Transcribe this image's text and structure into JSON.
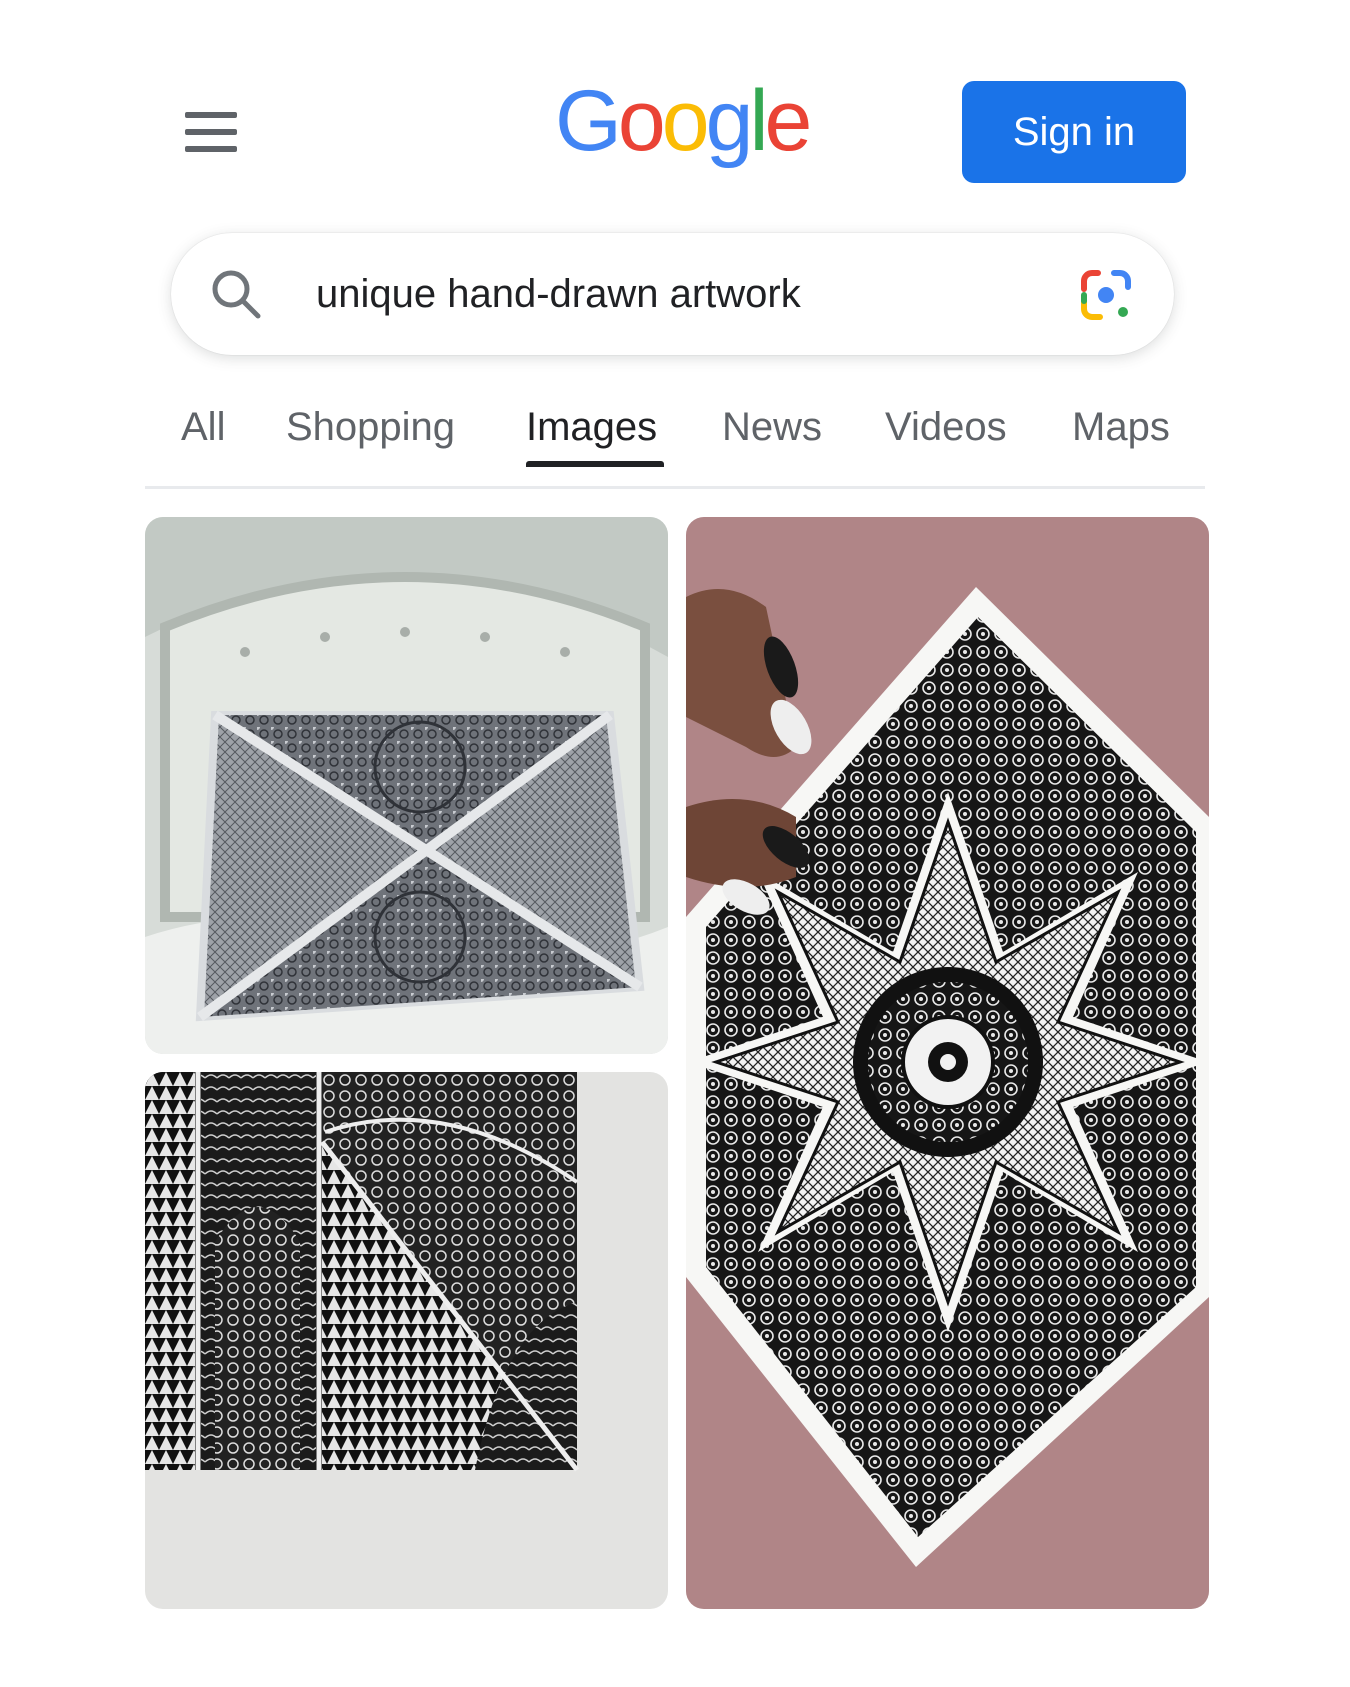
{
  "header": {
    "logo_letters": [
      {
        "char": "G",
        "color": "#4285F4"
      },
      {
        "char": "o",
        "color": "#EA4335"
      },
      {
        "char": "o",
        "color": "#FBBC05"
      },
      {
        "char": "g",
        "color": "#4285F4"
      },
      {
        "char": "l",
        "color": "#34A853"
      },
      {
        "char": "e",
        "color": "#EA4335"
      }
    ],
    "menu_icon": "hamburger-menu-icon",
    "signin_label": "Sign in"
  },
  "search": {
    "query": "unique hand-drawn artwork",
    "icon": "search-icon",
    "lens_icon": "google-lens-icon"
  },
  "tabs": [
    {
      "label": "All",
      "active": false
    },
    {
      "label": "Shopping",
      "active": false
    },
    {
      "label": "Images",
      "active": true
    },
    {
      "label": "News",
      "active": false
    },
    {
      "label": "Videos",
      "active": false
    },
    {
      "label": "Maps",
      "active": false
    }
  ],
  "images": [
    {
      "name": "image-result-1",
      "description_icon": "mandala-envelope-artwork"
    },
    {
      "name": "image-result-2",
      "description_icon": "mandala-star-artwork"
    },
    {
      "name": "image-result-3",
      "description_icon": "zentangle-panel-artwork"
    }
  ],
  "colors": {
    "accent": "#1a73e8",
    "text_primary": "#202124",
    "text_secondary": "#5f6368"
  }
}
